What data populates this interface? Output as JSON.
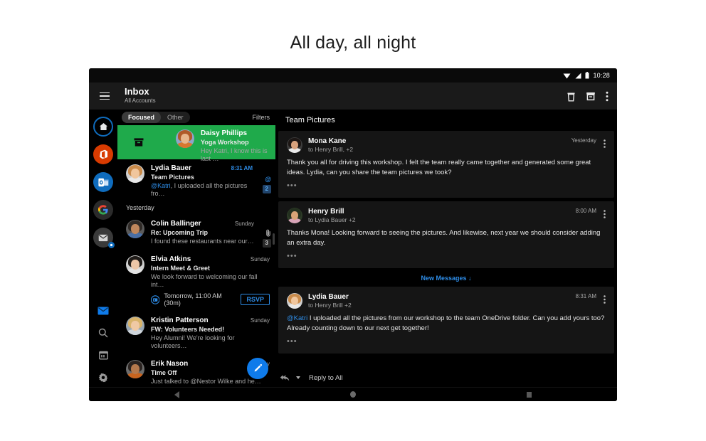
{
  "page": {
    "headline": "All day, all night"
  },
  "statusbar": {
    "time": "10:28",
    "icons": [
      "wifi-icon",
      "signal-icon",
      "battery-icon"
    ]
  },
  "toolbar": {
    "menu_icon": "hamburger-menu-icon",
    "title": "Inbox",
    "subtitle": "All Accounts",
    "actions": [
      {
        "name": "delete-button",
        "icon": "trash-icon"
      },
      {
        "name": "archive-button",
        "icon": "archive-icon"
      },
      {
        "name": "more-options-button",
        "icon": "kebab-menu-icon"
      }
    ]
  },
  "rail": {
    "accounts": [
      {
        "name": "home-account",
        "icon": "home-icon",
        "selected": true,
        "color": "#0f6cbd"
      },
      {
        "name": "office-account",
        "icon": "office-icon",
        "color": "#d83b01"
      },
      {
        "name": "outlook-account",
        "icon": "outlook-icon",
        "color": "#0f6cbd"
      },
      {
        "name": "google-account",
        "icon": "google-icon",
        "color": "#2b2b2b"
      },
      {
        "name": "other-mail-account",
        "icon": "mail-icon",
        "color": "#3a3a3a"
      }
    ],
    "bottom": [
      {
        "name": "mail-tab",
        "icon": "mail-icon",
        "active": true
      },
      {
        "name": "search-tab",
        "icon": "search-icon",
        "active": false
      },
      {
        "name": "calendar-tab",
        "icon": "calendar-icon",
        "active": false
      },
      {
        "name": "settings-tab",
        "icon": "gear-icon",
        "active": false
      }
    ]
  },
  "list": {
    "tabs": [
      {
        "label": "Focused",
        "active": true
      },
      {
        "label": "Other",
        "active": false
      }
    ],
    "filters_label": "Filters",
    "swipe_action_icon": "archive-icon",
    "swipe_action_color": "#1faa4b",
    "compose_fab": {
      "name": "compose-button",
      "icon": "pencil-icon",
      "color": "#0f7bea"
    },
    "groups": [
      {
        "header": null,
        "items": [
          {
            "sender": "Daisy Phillips",
            "subject": "Yoga Workshop",
            "preview": "Hey Katri, I know this is last …",
            "when": "",
            "swiped": true,
            "avatar": {
              "hair": "#b05a28",
              "skin": "#e8b68c",
              "body": "#d8772f",
              "bg": "#8fa4c8"
            }
          },
          {
            "sender": "Lydia Bauer",
            "subject": "Team Pictures",
            "preview_mention": "@Katri",
            "preview": ", I uploaded all the pictures fro…",
            "when": "8:31 AM",
            "when_highlight": true,
            "badge_at": "@",
            "badge_count": "2",
            "avatar": {
              "hair": "#c98b4b",
              "skin": "#f0c69d",
              "body": "#e8e8e8",
              "bg": "#cfcfcf"
            }
          }
        ]
      },
      {
        "header": "Yesterday",
        "items": [
          {
            "sender": "Colin Ballinger",
            "subject": "Re: Upcoming Trip",
            "preview": "I found these restaurants near our…",
            "when": "Sunday",
            "attachment_icon": "paperclip-icon",
            "badge_count_grey": "3",
            "avatar": {
              "hair": "#2f2a26",
              "skin": "#c0875c",
              "body": "#4a6fa5",
              "bg": "#5b5b5b"
            }
          },
          {
            "sender": "Elvia Atkins",
            "subject": "Intern Meet & Greet",
            "preview": "We look forward to welcoming our fall int…",
            "when": "Sunday",
            "rsvp": {
              "icon": "calendar-event-icon",
              "text": "Tomorrow, 11:00 AM (30m)",
              "button": "RSVP"
            },
            "avatar": {
              "hair": "#1f1b18",
              "skin": "#ecc6a8",
              "body": "#e3e3e3",
              "bg": "#d0d0d0"
            }
          },
          {
            "sender": "Kristin Patterson",
            "subject": "FW: Volunteers Needed!",
            "preview": "Hey Alumni! We're looking for volunteers…",
            "when": "Sunday",
            "avatar": {
              "hair": "#d8b36a",
              "skin": "#f0c9a4",
              "body": "#cfd6dc",
              "bg": "#9aa7b3"
            }
          },
          {
            "sender": "Erik Nason",
            "subject": "Time Off",
            "preview": "Just talked to @Nestor Wilke and he…",
            "when": "Sunday",
            "avatar": {
              "hair": "#2a2320",
              "skin": "#b5794d",
              "body": "#c8641f",
              "bg": "#6d6d6d"
            }
          }
        ]
      }
    ]
  },
  "reading": {
    "title": "Team Pictures",
    "new_messages_label": "New Messages",
    "new_messages_icon": "arrow-down-icon",
    "reply_bar": {
      "icon": "reply-all-icon",
      "caret": "chevron-down-icon",
      "label": "Reply to All"
    },
    "messages": [
      {
        "from": "Mona Kane",
        "to": "to Henry Brill, +2",
        "time": "Yesterday",
        "body": "Thank you all for driving this workshop. I felt the team really came together and generated some great ideas. Lydia, can you share the team pictures we took?",
        "expand_icon": "ellipsis-icon",
        "menu_icon": "kebab-menu-icon",
        "avatar": {
          "hair": "#1c1614",
          "skin": "#d8a27d",
          "body": "#e9e9e9",
          "bg": "#3c3c3c"
        }
      },
      {
        "from": "Henry Brill",
        "to": "to Lydia Bauer +2",
        "time": "8:00 AM",
        "body": "Thanks Mona! Looking forward to seeing the pictures. And likewise, next year we should consider adding an extra day.",
        "expand_icon": "ellipsis-icon",
        "menu_icon": "kebab-menu-icon",
        "avatar": {
          "hair": "#23301f",
          "skin": "#d9a477",
          "body": "#d8a4b8",
          "bg": "#2c3a26"
        }
      },
      {
        "from": "Lydia Bauer",
        "to": "to Henry Brill +2",
        "time": "8:31 AM",
        "body_mention": "@Katri",
        "body": " I uploaded all the pictures from our workshop to the team OneDrive folder. Can you add yours too? Already counting down to our next get together!",
        "expand_icon": "ellipsis-icon",
        "menu_icon": "kebab-menu-icon",
        "avatar": {
          "hair": "#c98b4b",
          "skin": "#f0c69d",
          "body": "#e8e8e8",
          "bg": "#cfcfcf"
        }
      }
    ]
  },
  "navbar": [
    {
      "name": "android-back-button",
      "icon": "triangle-back-icon"
    },
    {
      "name": "android-home-button",
      "icon": "circle-home-icon"
    },
    {
      "name": "android-recents-button",
      "icon": "square-recents-icon"
    }
  ],
  "colors": {
    "accent": "#2e8ce6",
    "fab": "#0f7bea",
    "swipe_archive": "#1faa4b",
    "app_bg": "#000000",
    "card_bg": "#151515"
  }
}
